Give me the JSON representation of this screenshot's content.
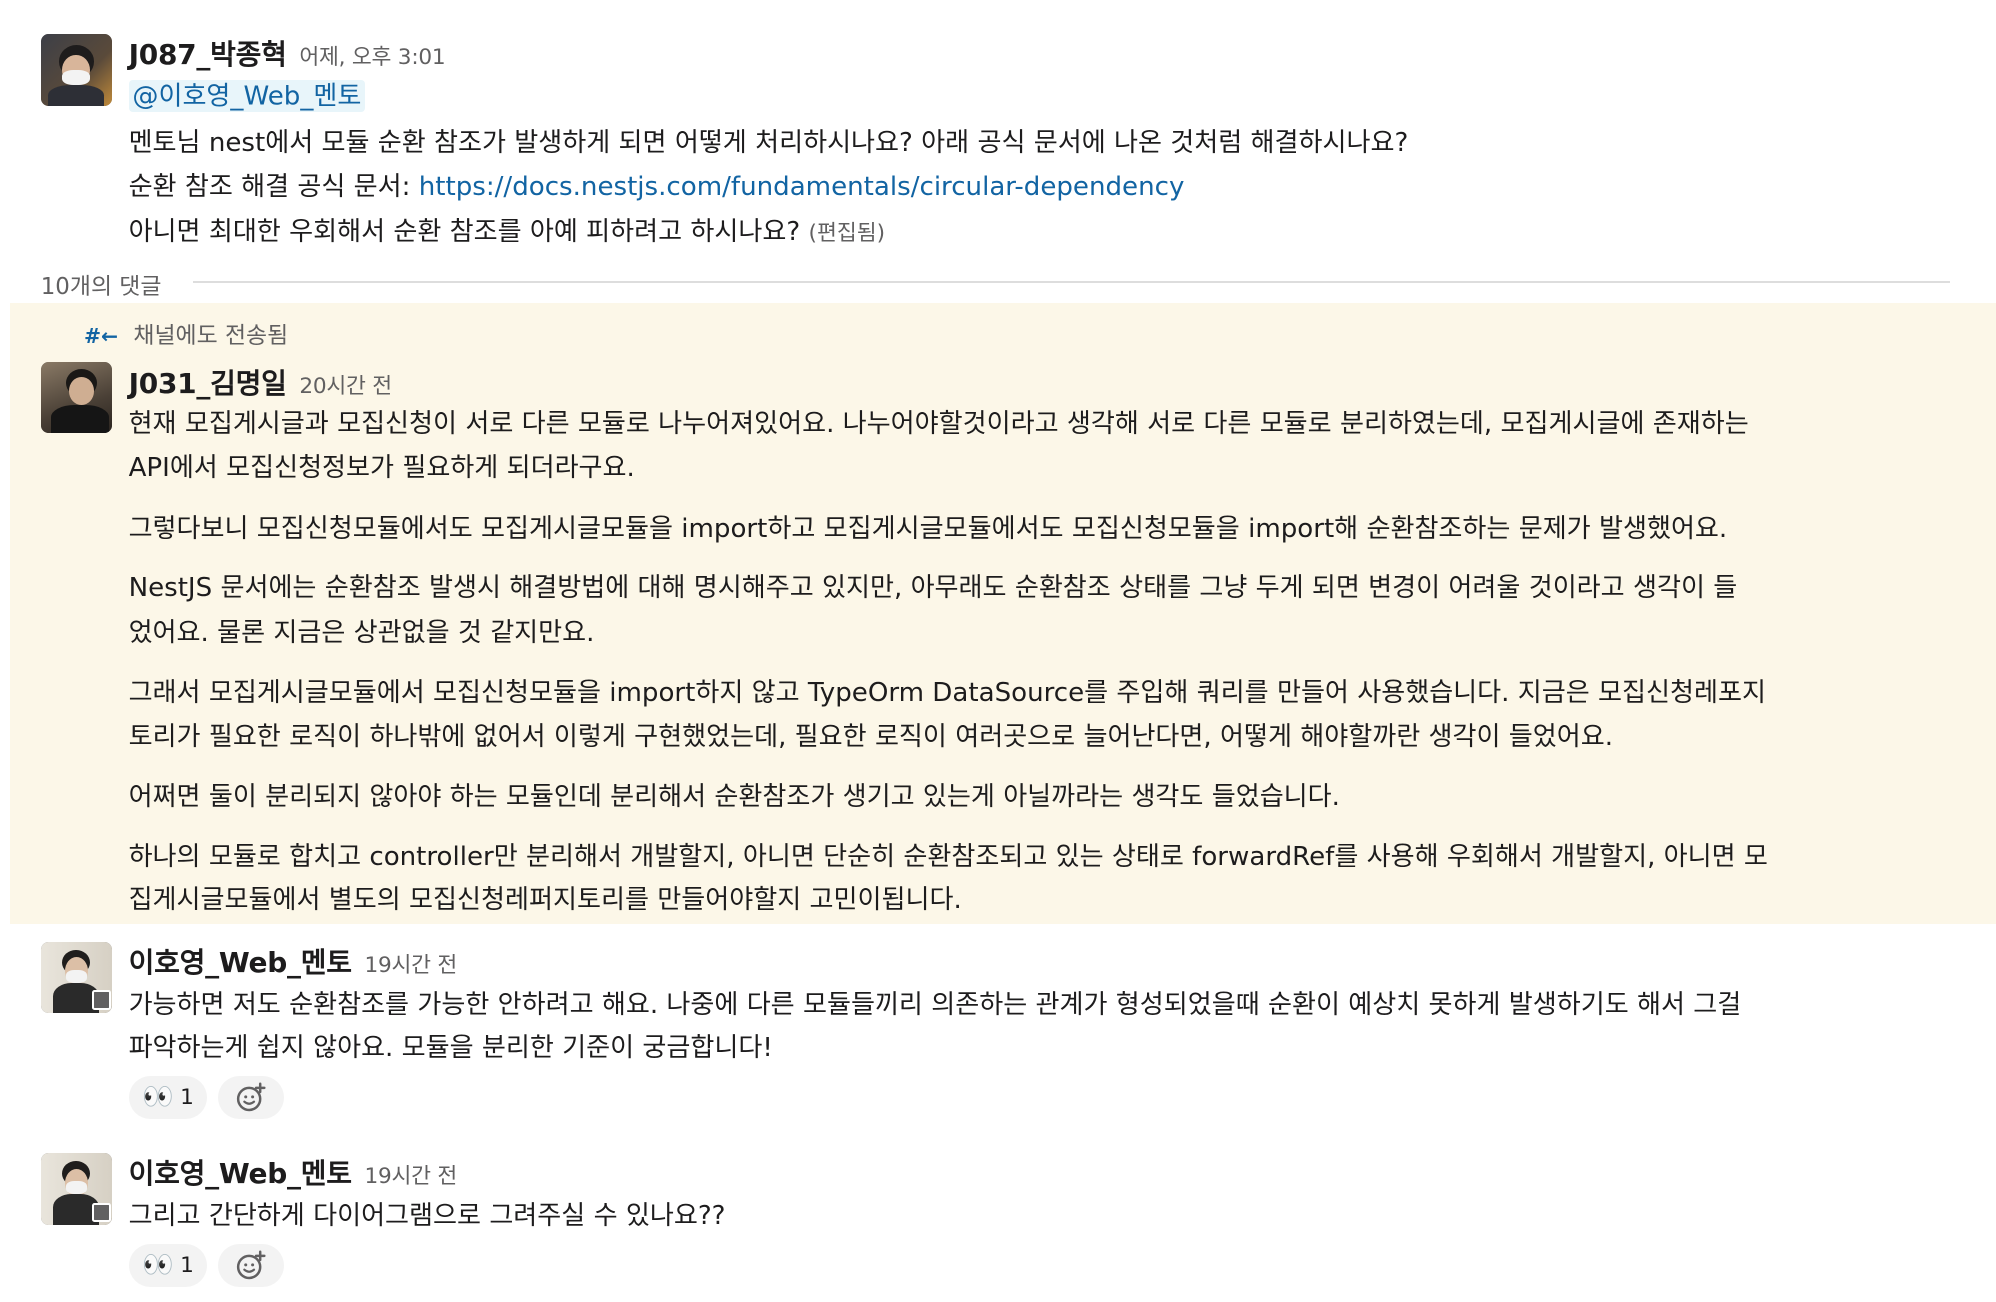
{
  "parent": {
    "author": "J087_박종혁",
    "time": "어제, 오후 3:01",
    "mention": "@이호영_Web_멘토",
    "line1": "멘토님 nest에서 모듈 순환 참조가 발생하게 되면 어떻게 처리하시나요? 아래 공식 문서에 나온 것처럼 해결하시나요?",
    "line2_prefix": "순환 참조 해결 공식 문서: ",
    "line2_link": "https://docs.nestjs.com/fundamentals/circular-dependency",
    "line3": "아니면 최대한 우회해서 순환 참조를 아예 피하려고 하시나요?",
    "edited": "(편집됨)"
  },
  "thread": {
    "reply_count": "10개의 댓글",
    "forwarded_label": "채널에도 전송됨",
    "forward_icon": "#←"
  },
  "reply1": {
    "author": "J031_김명일",
    "time": "20시간 전",
    "lines": [
      "현재 모집게시글과 모집신청이 서로 다른 모듈로 나누어져있어요. 나누어야할것이라고 생각해 서로 다른 모듈로 분리하였는데, 모집게시글에 존재하는",
      "API에서 모집신청정보가 필요하게 되더라구요.",
      "그렇다보니 모집신청모듈에서도 모집게시글모듈을 import하고 모집게시글모듈에서도 모집신청모듈을 import해 순환참조하는 문제가 발생했어요.",
      "NestJS 문서에는 순환참조 발생시 해결방법에 대해 명시해주고 있지만, 아무래도 순환참조 상태를 그냥 두게 되면 변경이 어려울 것이라고 생각이 들",
      "었어요. 물론 지금은 상관없을 것 같지만요.",
      "그래서 모집게시글모듈에서 모집신청모듈을 import하지 않고 TypeOrm DataSource를 주입해 쿼리를 만들어 사용했습니다. 지금은 모집신청레포지",
      "토리가 필요한 로직이 하나밖에 없어서 이렇게 구현했었는데, 필요한 로직이 여러곳으로 늘어난다면, 어떻게 해야할까란 생각이 들었어요.",
      "어쩌면 둘이 분리되지 않아야 하는 모듈인데 분리해서 순환참조가 생기고 있는게 아닐까라는 생각도 들었습니다.",
      "하나의 모듈로 합치고 controller만 분리해서 개발할지, 아니면 단순히 순환참조되고 있는 상태로 forwardRef를 사용해 우회해서 개발할지, 아니면 모",
      "집게시글모듈에서 별도의 모집신청레퍼지토리를 만들어야할지 고민이됩니다."
    ]
  },
  "reply2": {
    "author": "이호영_Web_멘토",
    "time": "19시간 전",
    "lines": [
      "가능하면 저도 순환참조를 가능한 안하려고 해요. 나중에 다른 모듈들끼리 의존하는 관계가 형성되었을때 순환이 예상치 못하게 발생하기도 해서 그걸",
      "파악하는게 쉽지 않아요. 모듈을 분리한 기준이 궁금합니다!"
    ],
    "reaction_emoji": "👀",
    "reaction_count": "1"
  },
  "reply3": {
    "author": "이호영_Web_멘토",
    "time": "19시간 전",
    "lines": [
      "그리고 간단하게 다이어그램으로 그려주실 수 있나요??"
    ],
    "reaction_emoji": "👀",
    "reaction_count": "1"
  },
  "colors": {
    "link": "#1264a3",
    "highlight_bg": "#fcf7e8",
    "mention_bg": "#e8f5fa",
    "muted": "#616061"
  },
  "icons": {
    "add_reaction": "add-reaction-icon",
    "forward": "forward-to-channel-icon"
  }
}
